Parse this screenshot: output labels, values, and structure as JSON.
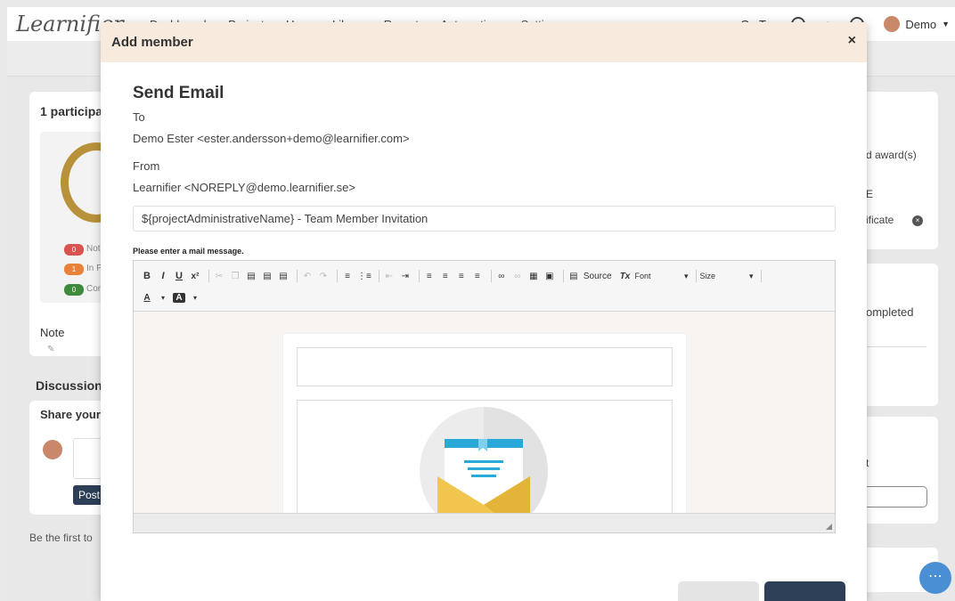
{
  "app": {
    "logo": "Learnifier",
    "nav": [
      "Dashboards",
      "Projects",
      "Users",
      "Library",
      "Reports",
      "Automations",
      "Settings"
    ],
    "goto": "Go To",
    "user_name": "Demo"
  },
  "background": {
    "participants_title": "1 participa",
    "status_pills": [
      {
        "count": "0",
        "label": "Not",
        "color": "#d9534f"
      },
      {
        "count": "1",
        "label": "In P",
        "color": "#e8823a"
      },
      {
        "count": "0",
        "label": "Con",
        "color": "#3f8a3c"
      }
    ],
    "note_label": "Note",
    "discussion_label": "Discussion",
    "share_label": "Share your",
    "post_button": "Post",
    "first_comment": "Be the first to",
    "right_award": "d award(s)",
    "right_e": "E",
    "right_certificate": "ificate",
    "right_completed": "ompleted",
    "right_t": "t"
  },
  "modal": {
    "title": "Add member",
    "close_symbol": "×",
    "heading": "Send Email",
    "to_label": "To",
    "to_value": "Demo Ester <ester.andersson+demo@learnifier.com>",
    "from_label": "From",
    "from_value": "Learnifier <NOREPLY@demo.learnifier.se>",
    "subject": "${projectAdministrativeName} - Team Member Invitation",
    "message_label": "Please enter a mail message."
  },
  "toolbar": {
    "bold": "B",
    "italic": "I",
    "underline": "U",
    "superscript": "x²",
    "source": "Source",
    "clear_format": "Tx",
    "font_combo": "Font",
    "size_combo": "Size",
    "text_color": "A",
    "bg_color": "A"
  },
  "colors": {
    "modal_header_bg": "#f8ebdd",
    "primary_button": "#2d3e57",
    "chat_bubble": "#4a8fd4",
    "envelope_yellow": "#f0c64f",
    "envelope_blue": "#29a9d8"
  }
}
